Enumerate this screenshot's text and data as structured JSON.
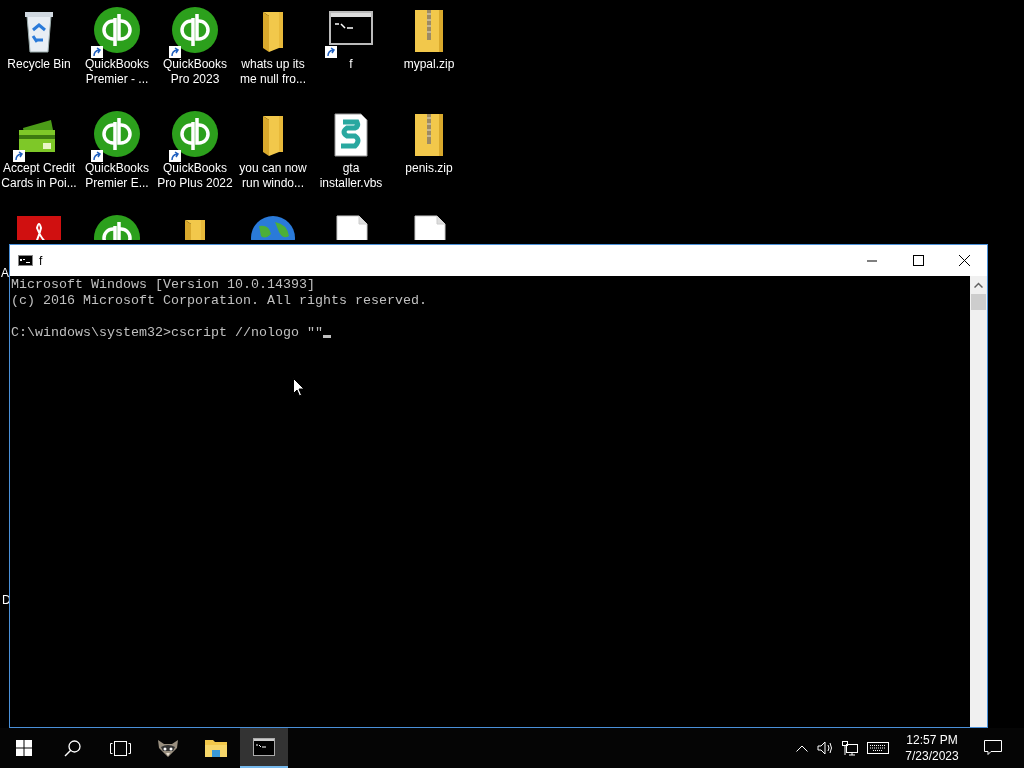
{
  "desktop": {
    "icons": [
      {
        "kind": "recycle",
        "shortcut": false,
        "lines": [
          "Recycle Bin"
        ]
      },
      {
        "kind": "quickbooks",
        "shortcut": true,
        "lines": [
          "QuickBooks",
          "Premier - ..."
        ]
      },
      {
        "kind": "quickbooks",
        "shortcut": true,
        "lines": [
          "QuickBooks",
          "Pro 2023"
        ]
      },
      {
        "kind": "folder",
        "shortcut": false,
        "lines": [
          "whats up its",
          "me null fro..."
        ]
      },
      {
        "kind": "console",
        "shortcut": true,
        "lines": [
          "f"
        ]
      },
      {
        "kind": "zip",
        "shortcut": false,
        "lines": [
          "mypal.zip"
        ]
      },
      {
        "kind": "cards",
        "shortcut": true,
        "lines": [
          "Accept Credit",
          "Cards in Poi..."
        ]
      },
      {
        "kind": "quickbooks",
        "shortcut": true,
        "lines": [
          "QuickBooks",
          "Premier E..."
        ]
      },
      {
        "kind": "quickbooks",
        "shortcut": true,
        "lines": [
          "QuickBooks",
          "Pro Plus 2022"
        ]
      },
      {
        "kind": "folder",
        "shortcut": false,
        "lines": [
          "you can now",
          "run windo..."
        ]
      },
      {
        "kind": "script",
        "shortcut": false,
        "lines": [
          "gta",
          "installer.vbs"
        ]
      },
      {
        "kind": "zip",
        "shortcut": false,
        "lines": [
          "penis.zip"
        ]
      },
      {
        "kind": "pdf",
        "shortcut": false
      },
      {
        "kind": "quickbooks",
        "shortcut": false
      },
      {
        "kind": "folder",
        "shortcut": false
      },
      {
        "kind": "globe",
        "shortcut": false
      },
      {
        "kind": "file",
        "shortcut": false
      },
      {
        "kind": "file",
        "shortcut": false
      }
    ],
    "label_fragments": [
      "A",
      "D"
    ]
  },
  "window": {
    "title": "f",
    "lines": [
      "Microsoft Windows [Version 10.0.14393]",
      "(c) 2016 Microsoft Corporation. All rights reserved."
    ],
    "prompt": "C:\\windows\\system32>cscript //nologo \"\"",
    "cursor": true
  },
  "taskbar": {
    "items": [
      {
        "kind": "start",
        "selected": false
      },
      {
        "kind": "search",
        "selected": false
      },
      {
        "kind": "taskview",
        "selected": false
      },
      {
        "kind": "raccoon",
        "selected": false
      },
      {
        "kind": "explorer",
        "selected": false
      },
      {
        "kind": "console",
        "selected": true
      }
    ],
    "clock": {
      "time": "12:57 PM",
      "date": "7/23/2023"
    }
  }
}
